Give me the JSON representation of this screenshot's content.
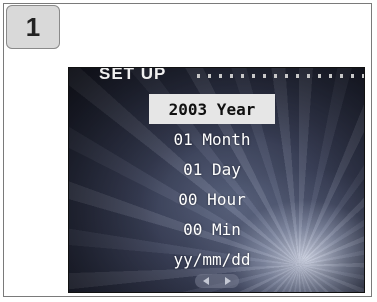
{
  "step": {
    "number": "1"
  },
  "screen": {
    "title": "SET UP",
    "menu": [
      {
        "label": "2003 Year",
        "selected": true
      },
      {
        "label": "01 Month",
        "selected": false
      },
      {
        "label": "01 Day",
        "selected": false
      },
      {
        "label": "00 Hour",
        "selected": false
      },
      {
        "label": "00 Min",
        "selected": false
      },
      {
        "label": "yy/mm/dd",
        "selected": false
      }
    ],
    "nav": {
      "left_icon": "triangle-left-icon",
      "right_icon": "triangle-right-icon"
    }
  },
  "colors": {
    "highlight": "#e6e6e6",
    "text": "#ffffff",
    "badge": "#d9d9d9"
  }
}
